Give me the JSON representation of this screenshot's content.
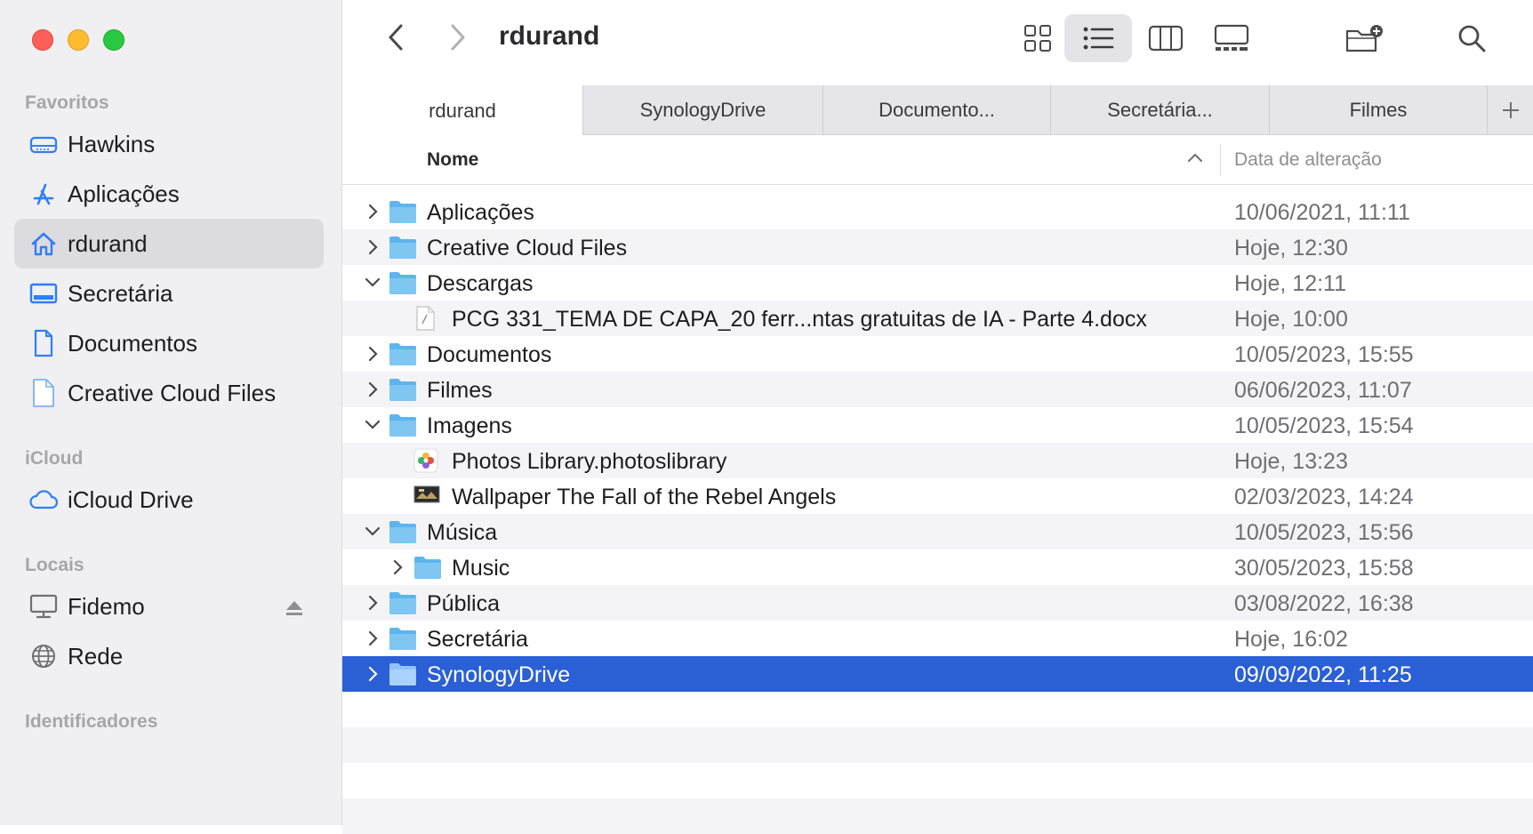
{
  "sidebar": {
    "sections": {
      "favorites": "Favoritos",
      "icloud": "iCloud",
      "locations": "Locais",
      "tags": "Identificadores"
    },
    "favorites": [
      {
        "label": "Hawkins",
        "icon": "drive-icon"
      },
      {
        "label": "Aplicações",
        "icon": "applications-icon"
      },
      {
        "label": "rdurand",
        "icon": "home-icon",
        "selected": true
      },
      {
        "label": "Secretária",
        "icon": "desktop-icon"
      },
      {
        "label": "Documentos",
        "icon": "document-icon"
      },
      {
        "label": "Creative Cloud Files",
        "icon": "file-icon"
      }
    ],
    "icloud": [
      {
        "label": "iCloud Drive",
        "icon": "cloud-icon"
      }
    ],
    "locations": [
      {
        "label": "Fidemo",
        "icon": "computer-icon"
      },
      {
        "label": "Rede",
        "icon": "globe-icon"
      }
    ]
  },
  "toolbar": {
    "title": "rdurand",
    "view_mode": "list"
  },
  "tabs": [
    {
      "label": "rdurand",
      "active": true
    },
    {
      "label": "SynologyDrive"
    },
    {
      "label": "Documento..."
    },
    {
      "label": "Secretária..."
    },
    {
      "label": "Filmes"
    }
  ],
  "columns": {
    "name": "Nome",
    "date": "Data de alteração"
  },
  "files": [
    {
      "name": "Aplicações",
      "date": "10/06/2021, 11:11",
      "level": 0,
      "expanded": false,
      "type": "folder"
    },
    {
      "name": "Creative Cloud Files",
      "date": "Hoje, 12:30",
      "level": 0,
      "expanded": false,
      "type": "folder"
    },
    {
      "name": "Descargas",
      "date": "Hoje, 12:11",
      "level": 0,
      "expanded": true,
      "type": "folder"
    },
    {
      "name": "PCG 331_TEMA DE CAPA_20 ferr...ntas gratuitas de IA - Parte 4.docx",
      "date": "Hoje, 10:00",
      "level": 1,
      "type": "docx"
    },
    {
      "name": "Documentos",
      "date": "10/05/2023, 15:55",
      "level": 0,
      "expanded": false,
      "type": "folder"
    },
    {
      "name": "Filmes",
      "date": "06/06/2023, 11:07",
      "level": 0,
      "expanded": false,
      "type": "folder"
    },
    {
      "name": "Imagens",
      "date": "10/05/2023, 15:54",
      "level": 0,
      "expanded": true,
      "type": "folder"
    },
    {
      "name": "Photos Library.photoslibrary",
      "date": "Hoje, 13:23",
      "level": 1,
      "type": "photos"
    },
    {
      "name": "Wallpaper The Fall of the Rebel Angels",
      "date": "02/03/2023, 14:24",
      "level": 1,
      "type": "image"
    },
    {
      "name": "Música",
      "date": "10/05/2023, 15:56",
      "level": 0,
      "expanded": true,
      "type": "folder"
    },
    {
      "name": "Music",
      "date": "30/05/2023, 15:58",
      "level": 1,
      "expanded": false,
      "type": "folder"
    },
    {
      "name": "Pública",
      "date": "03/08/2022, 16:38",
      "level": 0,
      "expanded": false,
      "type": "folder"
    },
    {
      "name": "Secretária",
      "date": "Hoje, 16:02",
      "level": 0,
      "expanded": false,
      "type": "folder"
    },
    {
      "name": "SynologyDrive",
      "date": "09/09/2022, 11:25",
      "level": 0,
      "expanded": false,
      "type": "folder",
      "selected": true
    }
  ],
  "colors": {
    "accent": "#2a5fd6",
    "folder": "#5db5ee",
    "sidebar_icon": "#2f7ef6"
  }
}
